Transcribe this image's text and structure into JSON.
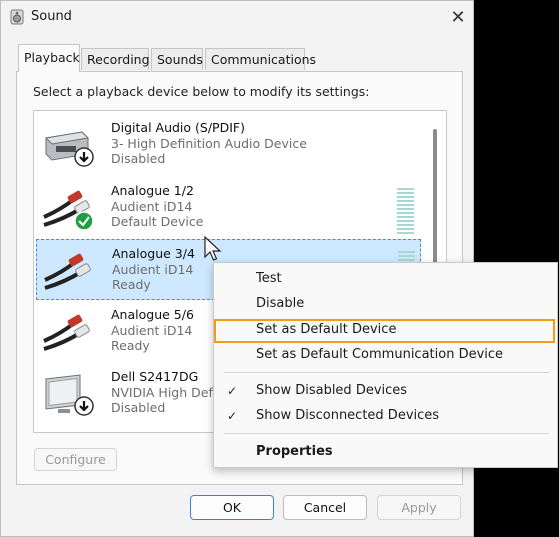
{
  "window": {
    "title": "Sound"
  },
  "tabs": [
    {
      "label": "Playback",
      "active": true
    },
    {
      "label": "Recording",
      "active": false
    },
    {
      "label": "Sounds",
      "active": false
    },
    {
      "label": "Communications",
      "active": false
    }
  ],
  "instruction": "Select a playback device below to modify its settings:",
  "devices": [
    {
      "name": "Digital Audio (S/PDIF)",
      "line2": "3- High Definition Audio Device",
      "status": "Disabled",
      "icon": "spdif-device-icon",
      "badge": "down-arrow"
    },
    {
      "name": "Analogue 1/2",
      "line2": "Audient iD14",
      "status": "Default Device",
      "icon": "rca-cable-icon",
      "badge": "default-check"
    },
    {
      "name": "Analogue 3/4",
      "line2": "Audient iD14",
      "status": "Ready",
      "icon": "rca-cable-icon",
      "selected": true
    },
    {
      "name": "Analogue 5/6",
      "line2": "Audient iD14",
      "status": "Ready",
      "icon": "rca-cable-icon"
    },
    {
      "name": "Dell S2417DG",
      "line2": "NVIDIA High Defi",
      "status": "Disabled",
      "icon": "monitor-icon",
      "badge": "down-arrow"
    }
  ],
  "buttons": {
    "configure": "Configure",
    "ok": "OK",
    "cancel": "Cancel",
    "apply": "Apply"
  },
  "context_menu": {
    "items": [
      "Test",
      "Disable",
      "Set as Default Device",
      "Set as Default Communication Device"
    ],
    "toggles": [
      {
        "label": "Show Disabled Devices",
        "checked": true
      },
      {
        "label": "Show Disconnected Devices",
        "checked": true
      }
    ],
    "properties": "Properties",
    "check_glyph": "✓",
    "highlighted": "Set as Default Device"
  },
  "colors": {
    "highlight": "#f59a1b",
    "selection": "#cde8ff",
    "accent": "#3c7fd9",
    "default_badge": "#1e9e43"
  }
}
